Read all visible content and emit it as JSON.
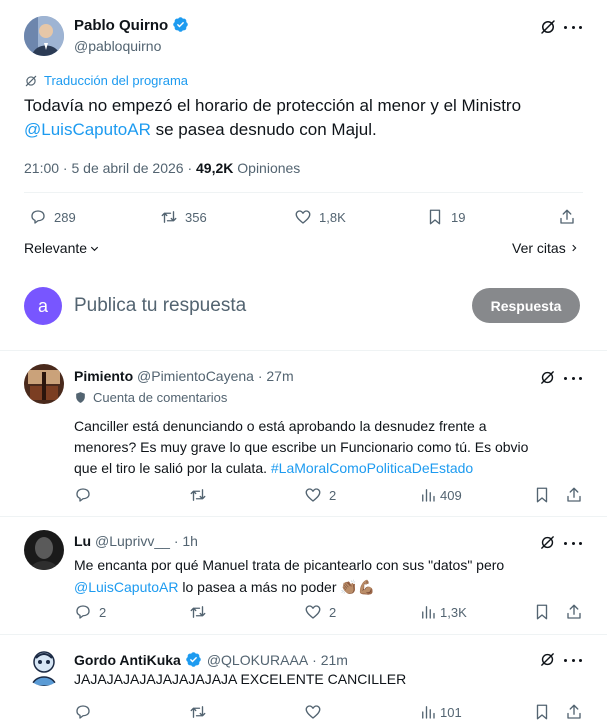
{
  "main_post": {
    "author_name": "Pablo Quirno",
    "handle": "@pabloquirno",
    "translation_label": "Traducción del programa",
    "text_line1": "Todavía no empezó el horario de protección al menor y el Ministro",
    "mention": "@LuisCaputoAR",
    "text_line2": " se pasea desnudo con Majul.",
    "time": "21:00 · 5 de abril de 2026 · ",
    "views": "49,2K",
    "views_label": " Opiniones",
    "replies": "289",
    "reposts": "356",
    "likes": "1,8K",
    "bookmarks": "19"
  },
  "sort": {
    "label": "Relevante",
    "quotes_link": "Ver citas"
  },
  "compose": {
    "avatar_letter": "a",
    "placeholder": "Publica tu respuesta",
    "button": "Respuesta"
  },
  "replies": [
    {
      "name": "Pimiento",
      "handle": "@PimientoCayena",
      "time": "· 27m",
      "account_label": "Cuenta de comentarios",
      "text1": "Canciller está denunciando o está aprobando la desnudez frente a",
      "text2": "menores? Es muy grave lo que escribe un Funcionario como tú. Es obvio",
      "text3": "que el tiro le salió por la culata. ",
      "hashtag": "#LaMoralComoPoliticaDeEstado",
      "replies": "",
      "reposts": "",
      "likes": "2",
      "views": "409"
    },
    {
      "name": "Lu",
      "handle": "@Luprivv__",
      "time": "· 1h",
      "text1": "Me encanta por qué Manuel trata de picantearlo con sus \"datos\" pero",
      "mention": "@LuisCaputoAR",
      "text2": " lo pasea a más no poder ",
      "emoji": "👏🏽💪🏽",
      "replies": "2",
      "reposts": "",
      "likes": "2",
      "views": "1,3K"
    },
    {
      "name": "Gordo AntiKuka",
      "handle": "@QLOKURAAA",
      "time": "· 21m",
      "text1": "JAJAJAJAJAJAJAJAJAJA EXCELENTE CANCILLER",
      "views": "101"
    }
  ],
  "colors": {
    "accent": "#1d9bf0",
    "text": "#0f1419",
    "muted": "#536471",
    "reply_button_bg": "#87898c",
    "compose_avatar": "#7856ff"
  }
}
